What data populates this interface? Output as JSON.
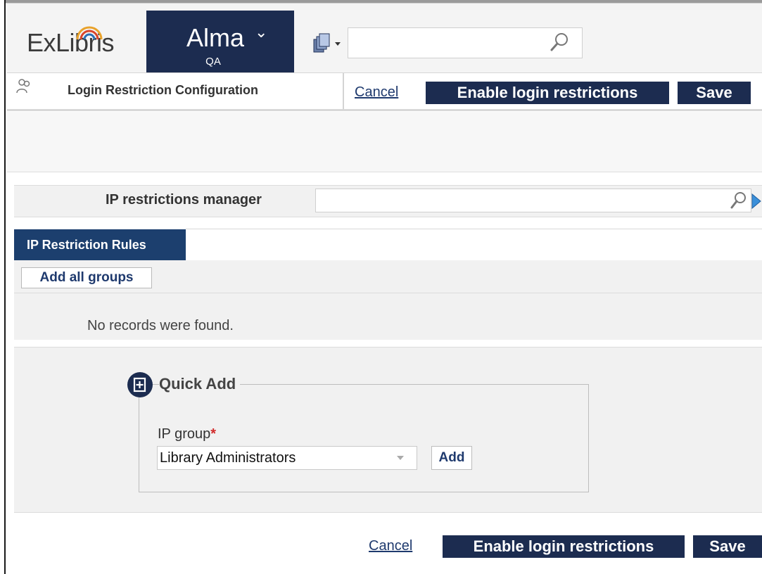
{
  "header": {
    "logo_text": "ExLibris",
    "app_name": "Alma",
    "environment": "QA",
    "search": {
      "value": "",
      "placeholder": ""
    }
  },
  "titlebar": {
    "title": "Login Restriction Configuration",
    "cancel_label": "Cancel",
    "enable_label": "Enable login restrictions",
    "save_label": "Save"
  },
  "manager": {
    "label": "IP restrictions manager",
    "value": ""
  },
  "rules": {
    "tab_label": "IP Restriction Rules",
    "add_all_label": "Add all groups",
    "empty_message": "No records were found."
  },
  "quick_add": {
    "title": "Quick Add",
    "field_label": "IP group",
    "required_mark": "*",
    "selected_value": "Library Administrators",
    "add_label": "Add"
  },
  "footer": {
    "cancel_label": "Cancel",
    "enable_label": "Enable login restrictions",
    "save_label": "Save"
  },
  "colors": {
    "brand_navy": "#1c2c50",
    "tab_blue": "#1c3f6e",
    "link_blue": "#1f3a6e",
    "required_red": "#d12b2b"
  },
  "icons": [
    "users-icon",
    "search-icon",
    "search-type-icon",
    "go-arrow-icon",
    "quick-add-icon",
    "chevron-down-icon"
  ]
}
